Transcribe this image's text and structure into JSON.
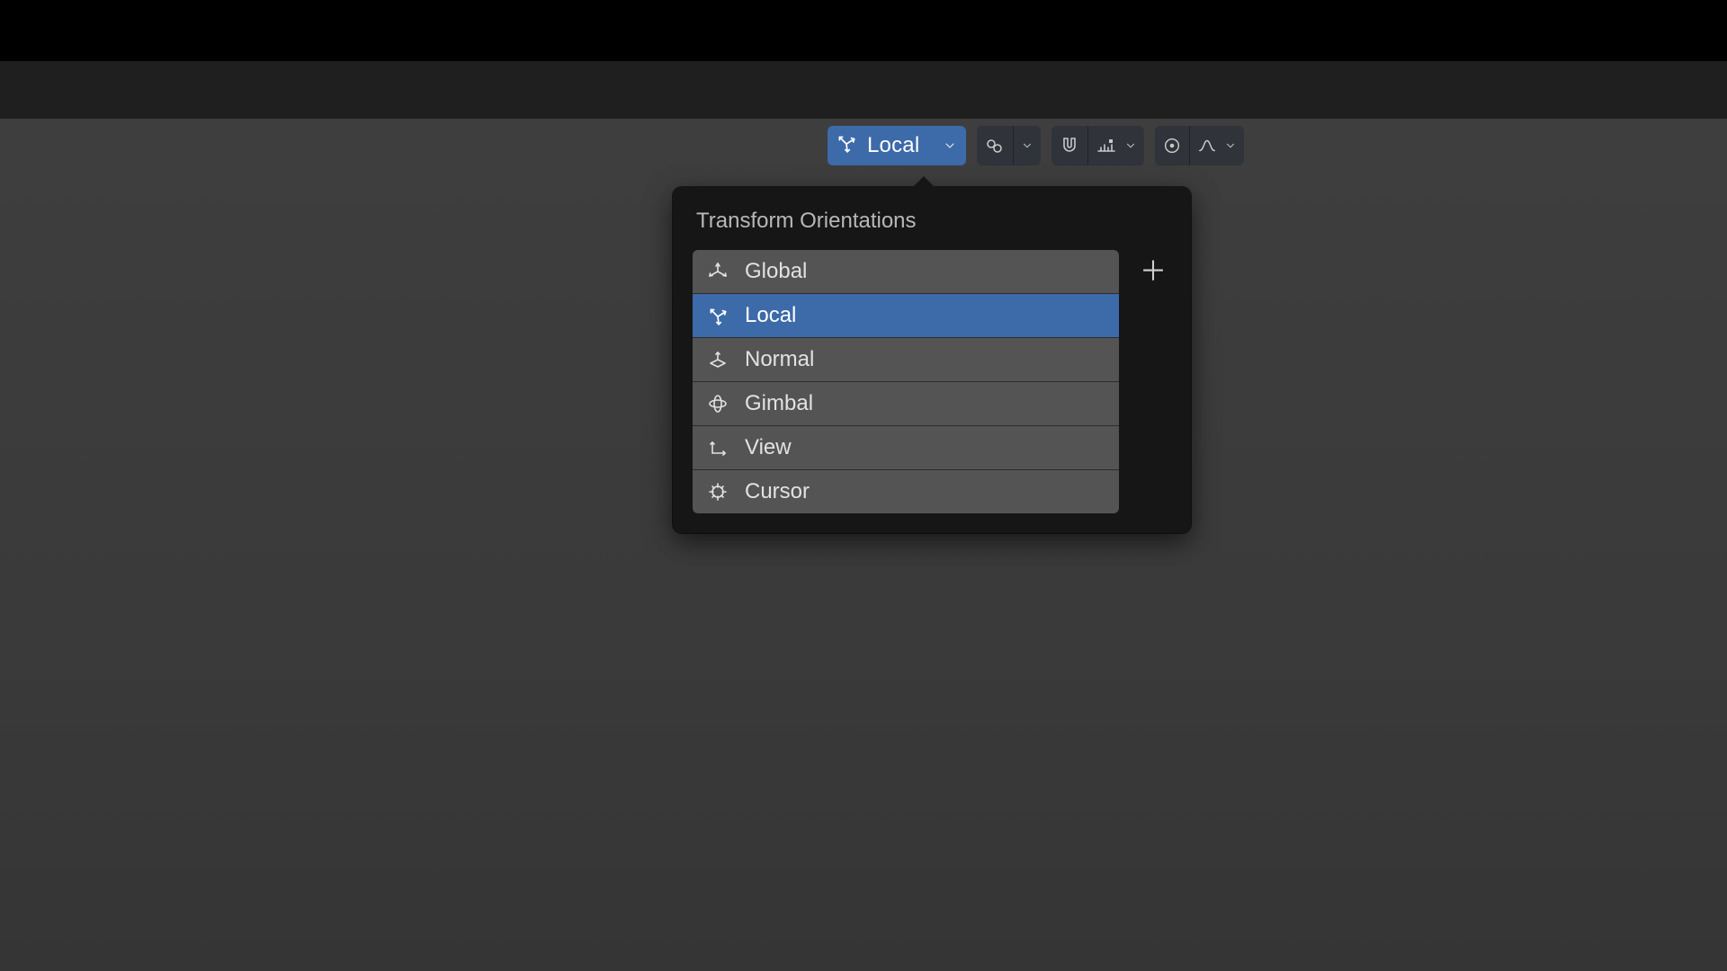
{
  "toolbar": {
    "orientation": {
      "selected_label": "Local",
      "selected_icon": "local-axes-icon"
    }
  },
  "popover": {
    "title": "Transform Orientations",
    "options": [
      {
        "icon": "global-axes-icon",
        "label": "Global",
        "selected": false
      },
      {
        "icon": "local-axes-icon",
        "label": "Local",
        "selected": true
      },
      {
        "icon": "normal-axes-icon",
        "label": "Normal",
        "selected": false
      },
      {
        "icon": "gimbal-axes-icon",
        "label": "Gimbal",
        "selected": false
      },
      {
        "icon": "view-axes-icon",
        "label": "View",
        "selected": false
      },
      {
        "icon": "cursor-axes-icon",
        "label": "Cursor",
        "selected": false
      }
    ],
    "add_button_glyph": "＋"
  }
}
